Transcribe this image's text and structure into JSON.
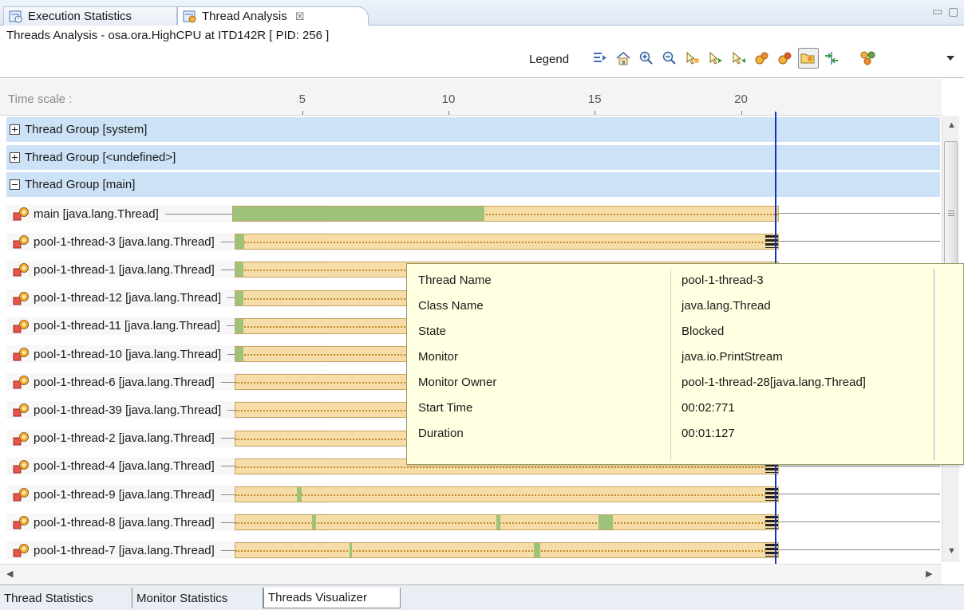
{
  "tabs": [
    {
      "label": "Execution Statistics",
      "active": false,
      "icon": "stopwatch-icon"
    },
    {
      "label": "Thread Analysis",
      "active": true,
      "icon": "thread-analysis-icon",
      "close": "☒"
    }
  ],
  "header": {
    "title": "Threads Analysis - osa.ora.HighCPU at ITD142R [ PID: 256 ]",
    "legend_label": "Legend",
    "toolbar": [
      "expand-all-icon",
      "home-icon",
      "zoom-in-icon",
      "zoom-out-icon",
      "select-icon",
      "select-next-icon",
      "select-prev-icon",
      "thread-icon",
      "thread-icon",
      "open-folder-icon",
      "split-icon",
      "threads-menu-icon",
      "dropdown-icon"
    ]
  },
  "timescale": {
    "label": "Time scale :",
    "ticks": [
      {
        "label": "5",
        "value": 5
      },
      {
        "label": "10",
        "value": 10
      },
      {
        "label": "15",
        "value": 15
      },
      {
        "label": "20",
        "value": 20
      }
    ],
    "cursor_value": 21.2
  },
  "groups": [
    {
      "label": "Thread Group [system]",
      "expanded": false
    },
    {
      "label": "Thread Group [<undefined>]",
      "expanded": false
    },
    {
      "label": "Thread Group [main]",
      "expanded": true
    }
  ],
  "threads": [
    {
      "name": "main [java.lang.Thread]",
      "start": 2.6,
      "end": 21.3,
      "running": [
        [
          2.6,
          11.2
        ]
      ],
      "blocked_end": false
    },
    {
      "name": "pool-1-thread-3 [java.lang.Thread]",
      "start": 2.7,
      "end": 21.3,
      "running": [
        [
          2.7,
          3.0
        ]
      ],
      "blocked_end": true
    },
    {
      "name": "pool-1-thread-1 [java.lang.Thread]",
      "start": 2.7,
      "end": 21.3,
      "running": [
        [
          2.7,
          2.95
        ]
      ],
      "blocked_end": true
    },
    {
      "name": "pool-1-thread-12 [java.lang.Thread]",
      "start": 2.7,
      "end": 21.3,
      "running": [
        [
          2.7,
          2.95
        ]
      ],
      "blocked_end": true
    },
    {
      "name": "pool-1-thread-11 [java.lang.Thread]",
      "start": 2.7,
      "end": 21.3,
      "running": [
        [
          2.7,
          2.95
        ]
      ],
      "blocked_end": true
    },
    {
      "name": "pool-1-thread-10 [java.lang.Thread]",
      "start": 2.7,
      "end": 21.3,
      "running": [
        [
          2.7,
          2.95
        ]
      ],
      "blocked_end": true
    },
    {
      "name": "pool-1-thread-6 [java.lang.Thread]",
      "start": 2.7,
      "end": 21.3,
      "running": [],
      "blocked_end": true
    },
    {
      "name": "pool-1-thread-39 [java.lang.Thread]",
      "start": 2.7,
      "end": 21.3,
      "running": [],
      "blocked_end": true
    },
    {
      "name": "pool-1-thread-2 [java.lang.Thread]",
      "start": 2.7,
      "end": 21.3,
      "running": [],
      "blocked_end": true
    },
    {
      "name": "pool-1-thread-4 [java.lang.Thread]",
      "start": 2.7,
      "end": 21.3,
      "running": [],
      "blocked_end": true
    },
    {
      "name": "pool-1-thread-9 [java.lang.Thread]",
      "start": 2.7,
      "end": 21.3,
      "running": [
        [
          4.8,
          4.95
        ]
      ],
      "blocked_end": true
    },
    {
      "name": "pool-1-thread-8 [java.lang.Thread]",
      "start": 2.7,
      "end": 21.3,
      "running": [
        [
          5.3,
          5.45
        ],
        [
          11.6,
          11.75
        ],
        [
          15.1,
          15.6
        ]
      ],
      "blocked_end": true
    },
    {
      "name": "pool-1-thread-7 [java.lang.Thread]",
      "start": 2.7,
      "end": 21.3,
      "running": [
        [
          6.6,
          6.65
        ],
        [
          12.9,
          13.1
        ]
      ],
      "blocked_end": true
    }
  ],
  "tooltip": {
    "rows": [
      {
        "key": "Thread Name",
        "value": "pool-1-thread-3"
      },
      {
        "key": "Class Name",
        "value": "java.lang.Thread"
      },
      {
        "key": "State",
        "value": "Blocked"
      },
      {
        "key": "Monitor",
        "value": "java.io.PrintStream"
      },
      {
        "key": "Monitor Owner",
        "value": "pool-1-thread-28[java.lang.Thread]"
      },
      {
        "key": "Start Time",
        "value": "00:02:771"
      },
      {
        "key": "Duration",
        "value": "00:01:127"
      }
    ]
  },
  "bottom_tabs": [
    {
      "label": "Thread Statistics",
      "active": false
    },
    {
      "label": "Monitor Statistics",
      "active": false
    },
    {
      "label": "Threads Visualizer",
      "active": true
    }
  ],
  "colors": {
    "running": "#9ec27a",
    "waiting": "#f6dca6",
    "waiting_border": "#c9a463",
    "group_bg": "#cde2f6",
    "cursor": "#1730c0",
    "tooltip_bg": "#ffffe1"
  }
}
